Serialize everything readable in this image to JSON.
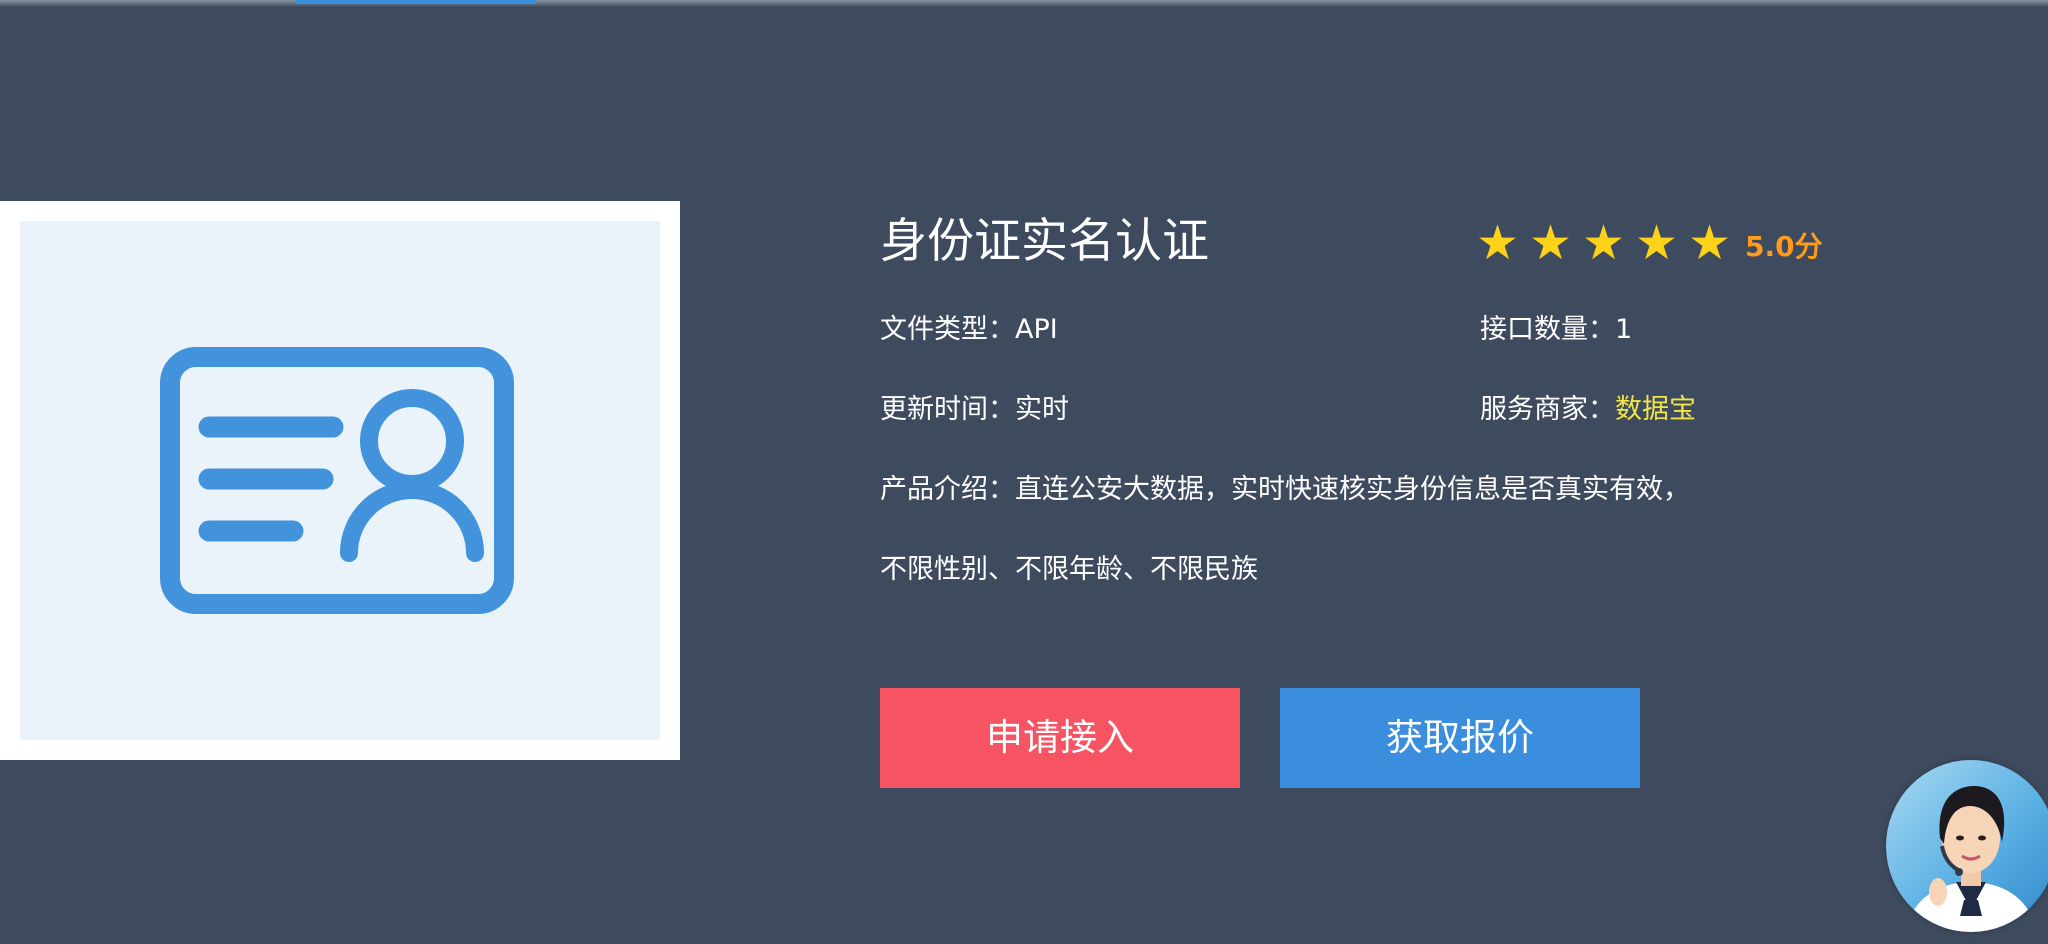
{
  "product": {
    "title": "身份证实名认证",
    "rating": 5,
    "score_text": "5.0分",
    "file_type_label": "文件类型：",
    "file_type_value": "API",
    "api_count_label": "接口数量：",
    "api_count_value": "1",
    "update_time_label": "更新时间：",
    "update_time_value": "实时",
    "provider_label": "服务商家：",
    "provider_value": "数据宝",
    "intro_label": "产品介绍：",
    "intro_line1": "直连公安大数据，实时快速核实身份信息是否真实有效，",
    "intro_line2": "不限性别、不限年龄、不限民族"
  },
  "actions": {
    "apply_label": "申请接入",
    "quote_label": "获取报价"
  },
  "icons": {
    "product_image": "id-card-icon",
    "star": "star-icon",
    "support": "customer-service-avatar"
  },
  "colors": {
    "background": "#3e4a5e",
    "star": "#ffd21a",
    "score": "#ff9a1a",
    "provider_highlight": "#f0e64a",
    "apply_button": "#f65463",
    "quote_button": "#3b8ddd",
    "id_card_stroke": "#4393dc",
    "accent_bar": "#3a8ede"
  }
}
